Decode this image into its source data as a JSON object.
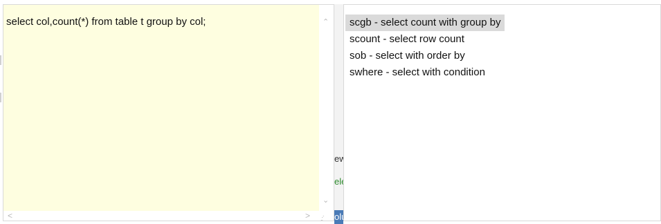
{
  "preview": {
    "text": "select col,count(*) from table t group by col;",
    "scroll_up": "^",
    "scroll_down": "v",
    "scroll_left": "<",
    "scroll_right": ">"
  },
  "background_fragments": {
    "ew": "ew",
    "ele": "ele",
    "olu": "olu"
  },
  "suggestions": [
    {
      "label": "scgb - select count with group by",
      "selected": true
    },
    {
      "label": "scount - select row count",
      "selected": false
    },
    {
      "label": "sob - select with order by",
      "selected": false
    },
    {
      "label": "swhere - select with condition",
      "selected": false
    }
  ]
}
